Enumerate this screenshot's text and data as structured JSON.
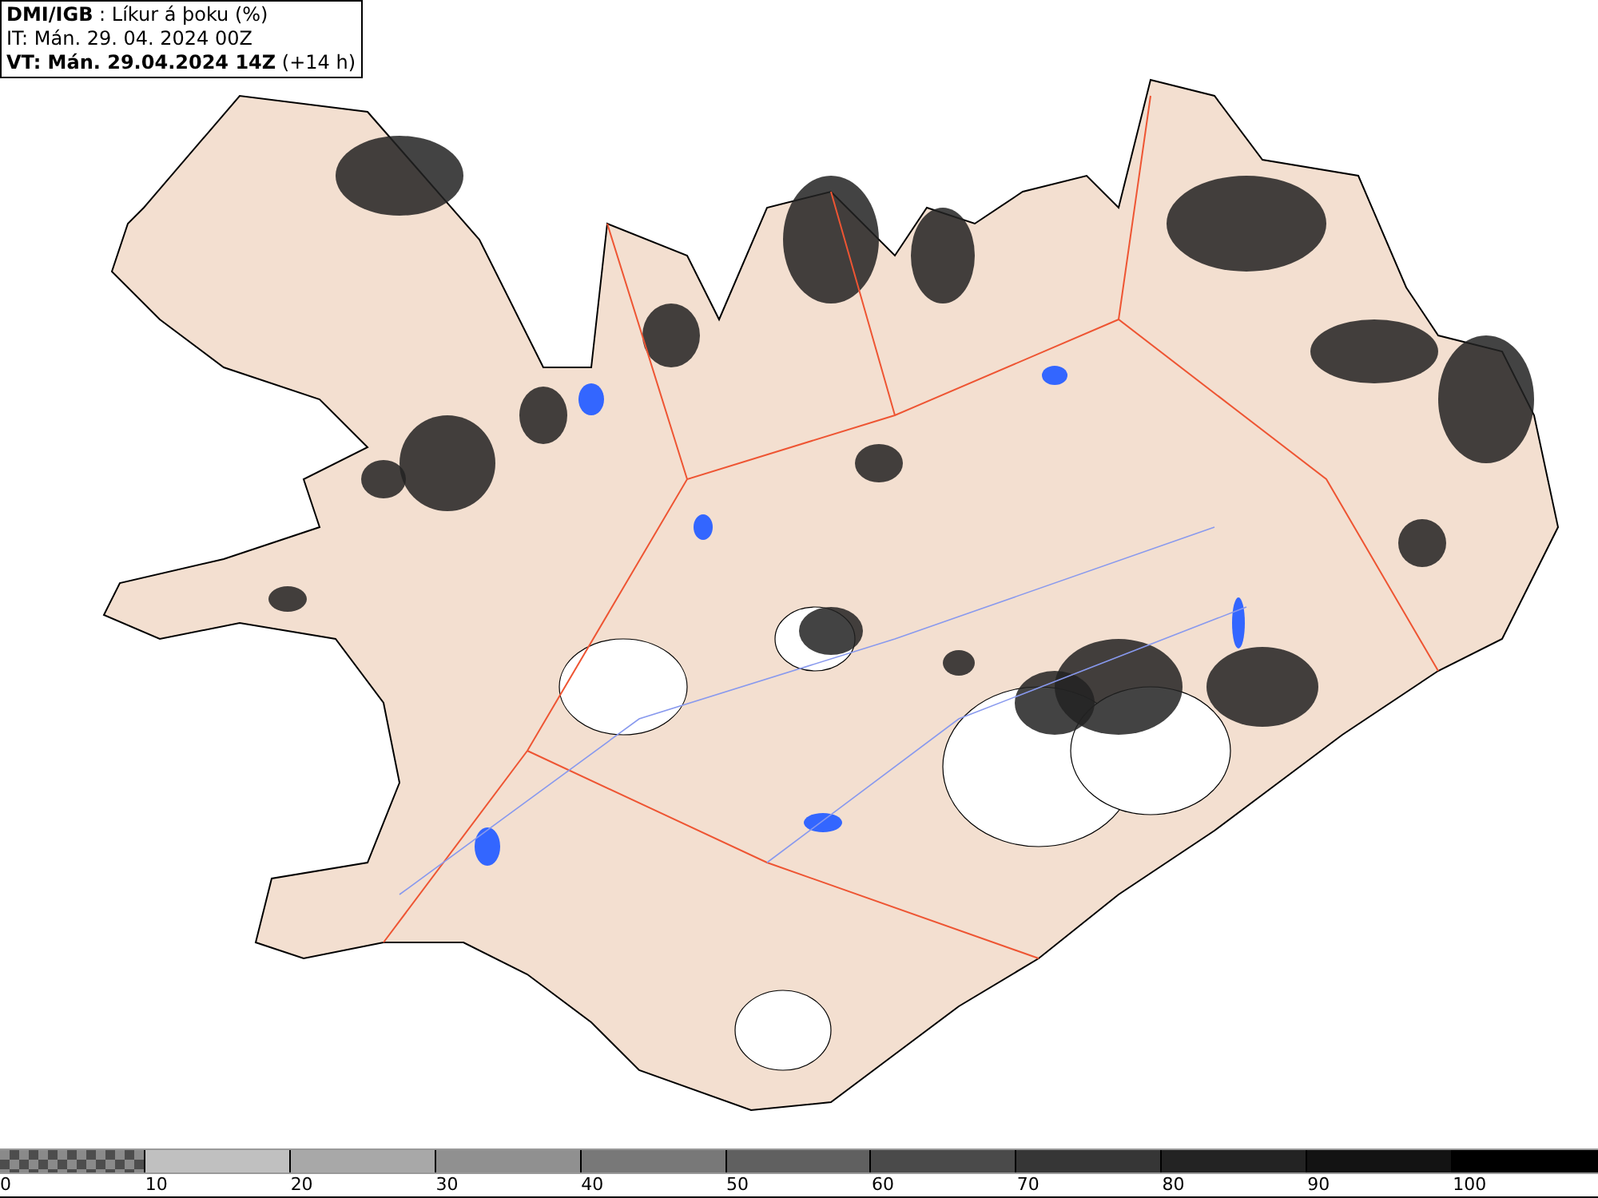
{
  "header": {
    "lines": [
      "**DMI/IGB** : Líkur á þoku (%)",
      "IT: Mán. 29. 04. 2024 00Z",
      "**VT: Mán. 29.04.2024 14Z** (+14 h)"
    ]
  },
  "legend": {
    "segments": [
      {
        "kind": "checker",
        "color": "#4d4d4d",
        "label": "0"
      },
      {
        "kind": "solid",
        "color": "#c0c0c0",
        "label": "10"
      },
      {
        "kind": "solid",
        "color": "#a8a8a8",
        "label": "20"
      },
      {
        "kind": "solid",
        "color": "#909090",
        "label": "30"
      },
      {
        "kind": "solid",
        "color": "#787878",
        "label": "40"
      },
      {
        "kind": "solid",
        "color": "#606060",
        "label": "50"
      },
      {
        "kind": "solid",
        "color": "#4a4a4a",
        "label": "60"
      },
      {
        "kind": "solid",
        "color": "#363636",
        "label": "70"
      },
      {
        "kind": "solid",
        "color": "#232323",
        "label": "80"
      },
      {
        "kind": "solid",
        "color": "#131313",
        "label": "90"
      },
      {
        "kind": "solid",
        "color": "#000000",
        "label": "100"
      }
    ]
  }
}
